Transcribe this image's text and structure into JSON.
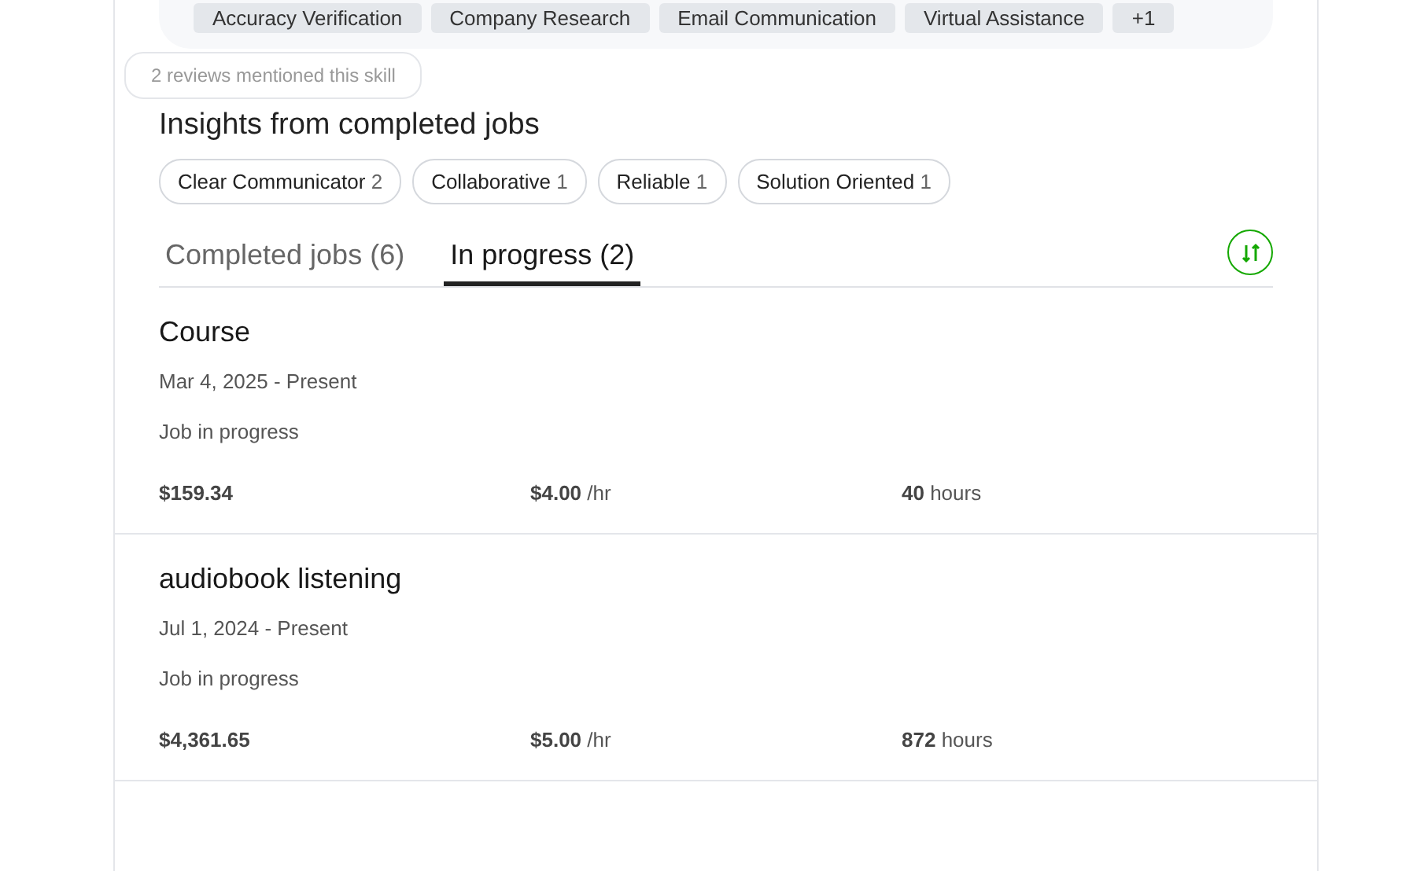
{
  "skills": {
    "tags": [
      "Accuracy Verification",
      "Company Research",
      "Email Communication",
      "Virtual Assistance"
    ],
    "more": "+1"
  },
  "tooltip": "2 reviews mentioned this skill",
  "insights": {
    "title": "Insights from completed jobs",
    "badges": [
      {
        "label": "Clear Communicator",
        "count": "2"
      },
      {
        "label": "Collaborative",
        "count": "1"
      },
      {
        "label": "Reliable",
        "count": "1"
      },
      {
        "label": "Solution Oriented",
        "count": "1"
      }
    ]
  },
  "tabs": [
    {
      "label": "Completed jobs (6)",
      "selected": false
    },
    {
      "label": "In progress (2)",
      "selected": true
    }
  ],
  "jobs": [
    {
      "title": "Course",
      "dates": "Mar 4, 2025 - Present",
      "status": "Job in progress",
      "earned": "$159.34",
      "rate": "$4.00",
      "rate_unit": "/hr",
      "hours": "40",
      "hours_unit": "hours"
    },
    {
      "title": "audiobook listening",
      "dates": "Jul 1, 2024 - Present",
      "status": "Job in progress",
      "earned": "$4,361.65",
      "rate": "$5.00",
      "rate_unit": "/hr",
      "hours": "872",
      "hours_unit": "hours"
    }
  ]
}
